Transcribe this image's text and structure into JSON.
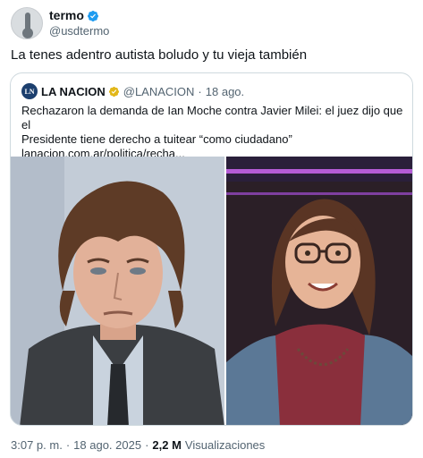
{
  "author": {
    "display_name": "termo",
    "handle": "@usdtermo",
    "avatar_icon": "thermometer-icon",
    "verified_color": "#1d9bf0"
  },
  "tweet": {
    "text": "La tenes adentro autista boludo y tu vieja también"
  },
  "quote": {
    "logo_text": "LN",
    "name": "LA NACION",
    "handle": "@LANACION",
    "dot": "·",
    "time": "18 ago.",
    "text_line1": "Rechazaron la demanda de Ian Moche contra Javier Milei: el juez dijo que el",
    "text_line2": "Presidente tiene derecho a tuitear “como ciudadano”",
    "link": "lanacion.com.ar/politica/recha...",
    "verified_color": "#e2b719"
  },
  "footer": {
    "time": "3:07 p. m.",
    "dot1": "·",
    "date": "18 ago. 2025",
    "dot2": "·",
    "views_count": "2,2 M",
    "views_label": "Visualizaciones"
  }
}
